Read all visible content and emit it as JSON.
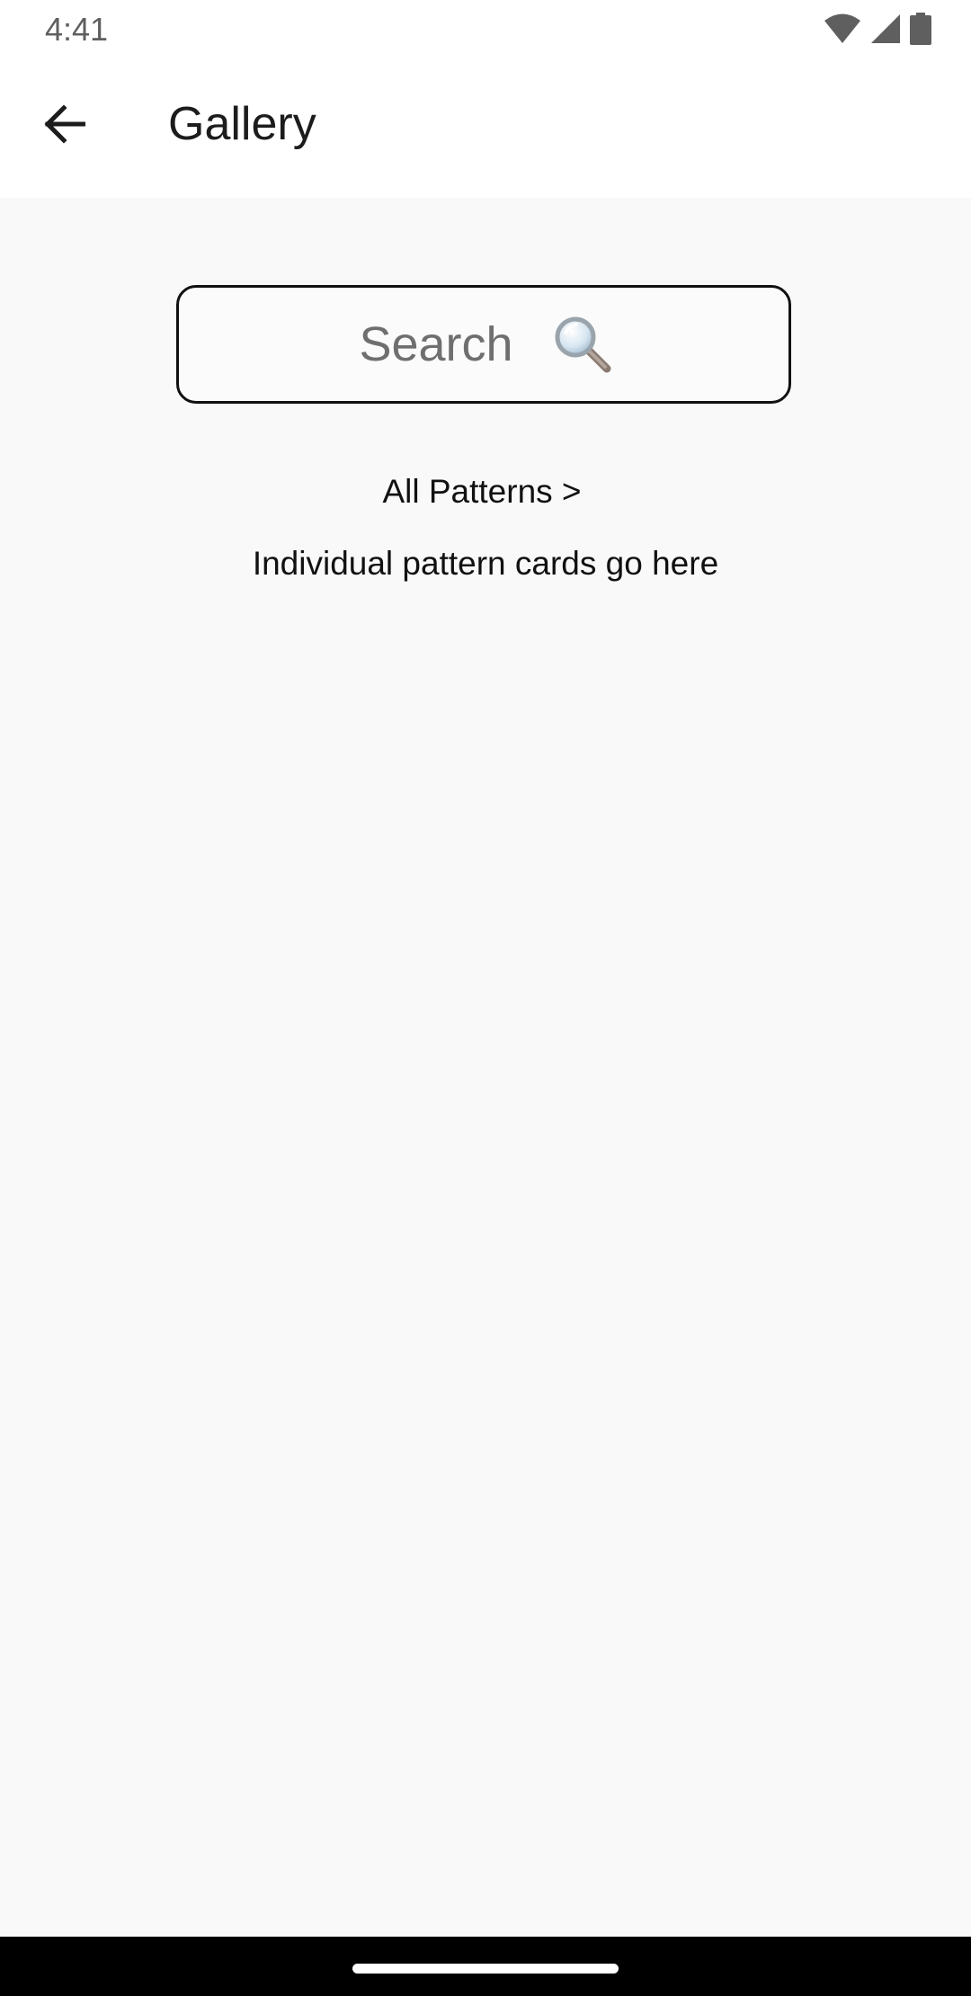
{
  "status_bar": {
    "time": "4:41",
    "icons": [
      "wifi-icon",
      "signal-icon",
      "battery-icon"
    ]
  },
  "app_bar": {
    "back_icon": "arrow-left-icon",
    "title": "Gallery"
  },
  "search": {
    "placeholder": "Search",
    "icon": "magnifier-icon"
  },
  "all_patterns_link": "All Patterns >",
  "placeholder_text": "Individual pattern cards go here",
  "colors": {
    "background": "#f9f9f9",
    "app_bar": "#ffffff",
    "text": "#111111",
    "nav_bar": "#000000"
  }
}
